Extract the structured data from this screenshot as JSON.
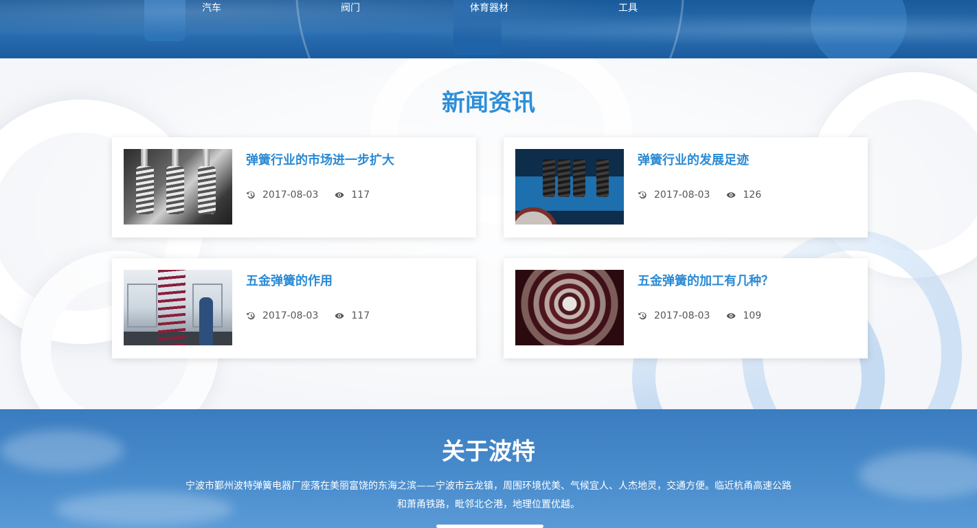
{
  "nav": {
    "items": [
      {
        "label": "汽车"
      },
      {
        "label": "阀门"
      },
      {
        "label": "体育器材"
      },
      {
        "label": "工具"
      }
    ]
  },
  "news": {
    "title": "新闻资讯",
    "items": [
      {
        "title": "弹簧行业的市场进一步扩大",
        "date": "2017-08-03",
        "views": "117",
        "image": "engine-valve-springs"
      },
      {
        "title": "弹簧行业的发展足迹",
        "date": "2017-08-03",
        "views": "126",
        "image": "train-bogie-springs"
      },
      {
        "title": "五金弹簧的作用",
        "date": "2017-08-03",
        "views": "117",
        "image": "red-coil-spring-lab"
      },
      {
        "title": "五金弹簧的加工有几种？",
        "date": "2017-08-03",
        "views": "109",
        "image": "spring-tunnel-view"
      }
    ]
  },
  "about": {
    "title": "关于波特",
    "line1": "宁波市鄞州波特弹簧电器厂座落在美丽富饶的东海之滨——宁波市云龙镇，周围环境优美、气候宜人、人杰地灵，交通方便。临近杭甬高速公路",
    "line2": "和萧甬铁路，毗邻北仑港，地理位置优越。"
  },
  "colors": {
    "accent": "#2d8ed8",
    "banner": "#1f63a8",
    "about_bg": "#4a8dcd"
  },
  "icons": {
    "date": "history-clock-icon",
    "views": "eye-icon"
  }
}
